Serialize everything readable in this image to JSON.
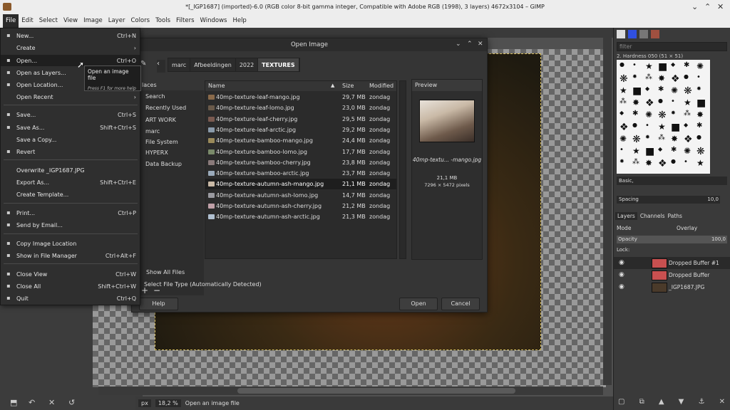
{
  "window": {
    "title": "*[_IGP1687] (imported)-6.0 (RGB color 8-bit gamma integer, Compatible with Adobe RGB (1998), 3 layers) 4672x3104 – GIMP"
  },
  "menubar": [
    "File",
    "Edit",
    "Select",
    "View",
    "Image",
    "Layer",
    "Colors",
    "Tools",
    "Filters",
    "Windows",
    "Help"
  ],
  "file_menu": [
    {
      "label": "New...",
      "shortcut": "Ctrl+N",
      "icon": "new-icon"
    },
    {
      "label": "Create",
      "shortcut": "›",
      "icon": ""
    },
    {
      "label": "Open...",
      "shortcut": "Ctrl+O",
      "icon": "open-icon"
    },
    {
      "label": "Open as Layers...",
      "shortcut": "Ctrl+Alt+O",
      "icon": "layers-icon"
    },
    {
      "label": "Open Location...",
      "shortcut": "",
      "icon": "location-icon"
    },
    {
      "label": "Open Recent",
      "shortcut": "›",
      "icon": ""
    },
    {
      "label": "Save...",
      "shortcut": "Ctrl+S",
      "icon": "save-icon"
    },
    {
      "label": "Save As...",
      "shortcut": "Shift+Ctrl+S",
      "icon": "save-as-icon"
    },
    {
      "label": "Save a Copy...",
      "shortcut": "",
      "icon": ""
    },
    {
      "label": "Revert",
      "shortcut": "",
      "icon": "revert-icon"
    },
    {
      "label": "Overwrite _IGP1687.JPG",
      "shortcut": "",
      "icon": ""
    },
    {
      "label": "Export As...",
      "shortcut": "Shift+Ctrl+E",
      "icon": ""
    },
    {
      "label": "Create Template...",
      "shortcut": "",
      "icon": ""
    },
    {
      "label": "Print...",
      "shortcut": "Ctrl+P",
      "icon": "print-icon"
    },
    {
      "label": "Send by Email...",
      "shortcut": "",
      "icon": "email-icon"
    },
    {
      "label": "Copy Image Location",
      "shortcut": "",
      "icon": "copy-icon"
    },
    {
      "label": "Show in File Manager",
      "shortcut": "Ctrl+Alt+F",
      "icon": "folder-icon"
    },
    {
      "label": "Close View",
      "shortcut": "Ctrl+W",
      "icon": "close-icon"
    },
    {
      "label": "Close All",
      "shortcut": "Shift+Ctrl+W",
      "icon": "close-all-icon"
    },
    {
      "label": "Quit",
      "shortcut": "Ctrl+Q",
      "icon": "quit-icon"
    }
  ],
  "tooltip": {
    "title": "Open an image file",
    "hint": "Press F1 for more help"
  },
  "dialog": {
    "title": "Open Image",
    "crumbs": [
      "marc",
      "Afbeeldingen",
      "2022",
      "TEXTURES"
    ],
    "places_header": "laces",
    "places": [
      "Search",
      "Recently Used",
      "ART WORK",
      "marc",
      "File System",
      "HYPERX",
      "Data Backup"
    ],
    "columns": {
      "name": "Name",
      "size": "Size",
      "modified": "Modified"
    },
    "files": [
      {
        "name": "40mp-texture-leaf-mango.jpg",
        "size": "29,7 MB",
        "modified": "zondag",
        "color": "#8a6a4a"
      },
      {
        "name": "40mp-texture-leaf-lomo.jpg",
        "size": "23,0 MB",
        "modified": "zondag",
        "color": "#6a5a4a"
      },
      {
        "name": "40mp-texture-leaf-cherry.jpg",
        "size": "29,5 MB",
        "modified": "zondag",
        "color": "#7a5a50"
      },
      {
        "name": "40mp-texture-leaf-arctic.jpg",
        "size": "29,2 MB",
        "modified": "zondag",
        "color": "#8a9aaa"
      },
      {
        "name": "40mp-texture-bamboo-mango.jpg",
        "size": "24,4 MB",
        "modified": "zondag",
        "color": "#9a8a5a"
      },
      {
        "name": "40mp-texture-bamboo-lomo.jpg",
        "size": "17,7 MB",
        "modified": "zondag",
        "color": "#7a8a6a"
      },
      {
        "name": "40mp-texture-bamboo-cherry.jpg",
        "size": "23,8 MB",
        "modified": "zondag",
        "color": "#8a7a7a"
      },
      {
        "name": "40mp-texture-bamboo-arctic.jpg",
        "size": "23,7 MB",
        "modified": "zondag",
        "color": "#9aaaba"
      },
      {
        "name": "40mp-texture-autumn-ash-mango.jpg",
        "size": "21,1 MB",
        "modified": "zondag",
        "color": "#c9b9a6"
      },
      {
        "name": "40mp-texture-autumn-ash-lomo.jpg",
        "size": "14,7 MB",
        "modified": "zondag",
        "color": "#9a9aa0"
      },
      {
        "name": "40mp-texture-autumn-ash-cherry.jpg",
        "size": "21,2 MB",
        "modified": "zondag",
        "color": "#c0a0a8"
      },
      {
        "name": "40mp-texture-autumn-ash-arctic.jpg",
        "size": "21,3 MB",
        "modified": "zondag",
        "color": "#b0c0d0"
      }
    ],
    "preview": {
      "header": "Preview",
      "name": "40mp-textu... -mango.jpg",
      "size": "21,1 MB",
      "dims": "7296 × 5472 pixels"
    },
    "show_all": "Show All Files",
    "file_type": "Select File Type (Automatically Detected)",
    "buttons": {
      "help": "Help",
      "open": "Open",
      "cancel": "Cancel"
    }
  },
  "dock": {
    "filter": "filter",
    "brush_name": "2. Hardness 050 (51 × 51)",
    "brush_set": "Basic,",
    "spacing_label": "Spacing",
    "spacing_value": "10,0",
    "tabs": [
      "Layers",
      "Channels",
      "Paths"
    ],
    "mode_label": "Mode",
    "mode_value": "Overlay",
    "opacity_label": "Opacity",
    "opacity_value": "100,0",
    "lock_label": "Lock:",
    "layers": [
      {
        "name": "Dropped Buffer #1",
        "color": "#c95050"
      },
      {
        "name": "Dropped Buffer",
        "color": "#c95050"
      },
      {
        "name": "_IGP1687.JPG",
        "color": "#4a3a2a"
      }
    ]
  },
  "status": {
    "unit": "px",
    "zoom": "18,2 %",
    "message": "Open an image file"
  }
}
